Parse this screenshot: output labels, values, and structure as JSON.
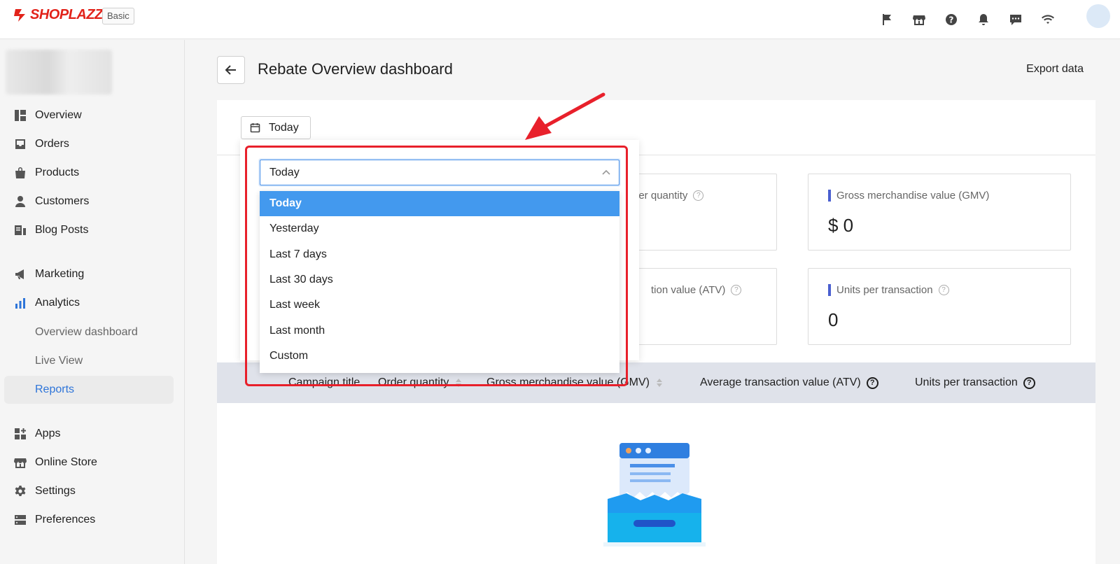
{
  "topbar": {
    "brand": "SHOPLAZZA",
    "plan": "Basic",
    "icons": [
      "flag-icon",
      "store-icon",
      "help-icon",
      "bell-icon",
      "chat-icon",
      "wifi-icon"
    ]
  },
  "sidebar": {
    "items": [
      {
        "label": "Overview",
        "icon": "overview-icon"
      },
      {
        "label": "Orders",
        "icon": "inbox-icon"
      },
      {
        "label": "Products",
        "icon": "bag-icon"
      },
      {
        "label": "Customers",
        "icon": "person-icon"
      },
      {
        "label": "Blog Posts",
        "icon": "blog-icon"
      },
      {
        "label": "Marketing",
        "icon": "megaphone-icon"
      },
      {
        "label": "Analytics",
        "icon": "bar-chart-icon"
      },
      {
        "label": "Apps",
        "icon": "apps-icon"
      },
      {
        "label": "Online Store",
        "icon": "store-icon"
      },
      {
        "label": "Settings",
        "icon": "gear-icon"
      },
      {
        "label": "Preferences",
        "icon": "preferences-icon"
      }
    ],
    "analytics_sub": [
      {
        "label": "Overview dashboard"
      },
      {
        "label": "Live View"
      },
      {
        "label": "Reports"
      }
    ]
  },
  "page": {
    "title": "Rebate Overview dashboard",
    "export": "Export data",
    "date_button": "Today"
  },
  "metrics": [
    {
      "label": "der quantity",
      "value": ""
    },
    {
      "label": "Gross merchandise value (GMV)",
      "value": "$ 0"
    },
    {
      "label": "tion value (ATV)",
      "value": ""
    },
    {
      "label": "Units per transaction",
      "value": "0"
    }
  ],
  "table": {
    "headers": [
      "Campaign title",
      "Order quantity",
      "Gross merchandise value (GMV)",
      "Average transaction value (ATV)",
      "Units per transaction"
    ]
  },
  "dropdown": {
    "selected": "Today",
    "options": [
      "Today",
      "Yesterday",
      "Last 7 days",
      "Last 30 days",
      "Last week",
      "Last month",
      "Custom"
    ]
  },
  "colors": {
    "brand": "#e2231a",
    "accent": "#2e75d9",
    "selected_option": "#4399ee",
    "annotation": "#e8202b"
  }
}
